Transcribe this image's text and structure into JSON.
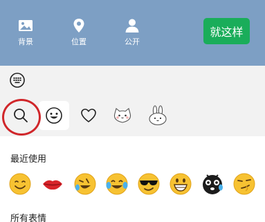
{
  "toolbar": {
    "background_label": "背景",
    "location_label": "位置",
    "public_label": "公开",
    "done_label": "就这样"
  },
  "sections": {
    "recent": "最近使用",
    "all": "所有表情"
  },
  "tabs": [
    "search",
    "emoji",
    "heart",
    "cat-sticker",
    "rabbit-sticker"
  ],
  "recent_emojis": [
    "smile",
    "lips",
    "rofl",
    "joy",
    "cool",
    "grin",
    "mask-tear",
    "smirk"
  ],
  "colors": {
    "toolbar_bg": "#7d9fc4",
    "done_button": "#1aad5a",
    "highlight": "#d0262a",
    "emoji_yellow": "#f7c232"
  }
}
